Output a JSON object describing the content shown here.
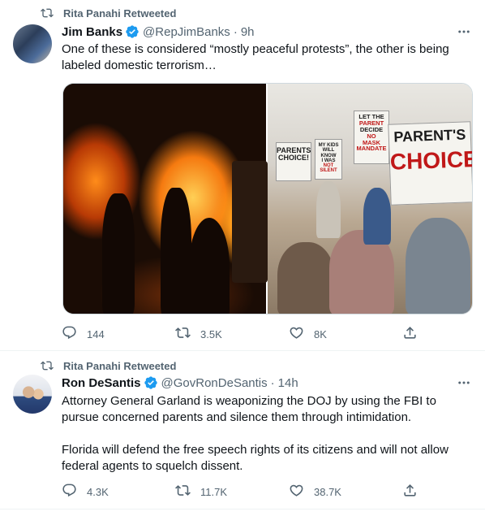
{
  "tweets": [
    {
      "retweeted_by": "Rita Panahi Retweeted",
      "author_name": "Jim Banks",
      "handle": "@RepJimBanks",
      "separator": "·",
      "time": "9h",
      "text": [
        "One of these is considered “mostly peaceful protests”, the other is being labeled domestic terrorism…"
      ],
      "signs": {
        "a": [
          "LET THE",
          "PARENT",
          "DECIDE",
          "NO",
          "MASK",
          "MANDATE"
        ],
        "b": [
          "PARENTS",
          "CHOICE!"
        ],
        "c": [
          "MY KIDS",
          "WILL KNOW",
          "I WAS",
          "NOT SILENT"
        ],
        "d_top": "PARENT'S",
        "d_bottom": "CHOICE"
      },
      "replies": "144",
      "retweets": "3.5K",
      "likes": "8K"
    },
    {
      "retweeted_by": "Rita Panahi Retweeted",
      "author_name": "Ron DeSantis",
      "handle": "@GovRonDeSantis",
      "separator": "·",
      "time": "14h",
      "text": [
        "Attorney General Garland is weaponizing the DOJ by using the FBI to pursue concerned parents and silence them through intimidation.",
        "Florida will defend the free speech rights of its citizens and will not allow federal agents to squelch dissent."
      ],
      "replies": "4.3K",
      "retweets": "11.7K",
      "likes": "38.7K"
    }
  ],
  "colors": {
    "text_primary": "#0f1419",
    "text_secondary": "#536471",
    "verified_blue": "#1d9bf0",
    "divider": "#eff3f4"
  },
  "icons": {
    "retweet": "retweet-icon",
    "verified": "verified-badge-icon",
    "more": "more-icon",
    "reply": "reply-icon",
    "like": "like-icon",
    "share": "share-icon"
  }
}
